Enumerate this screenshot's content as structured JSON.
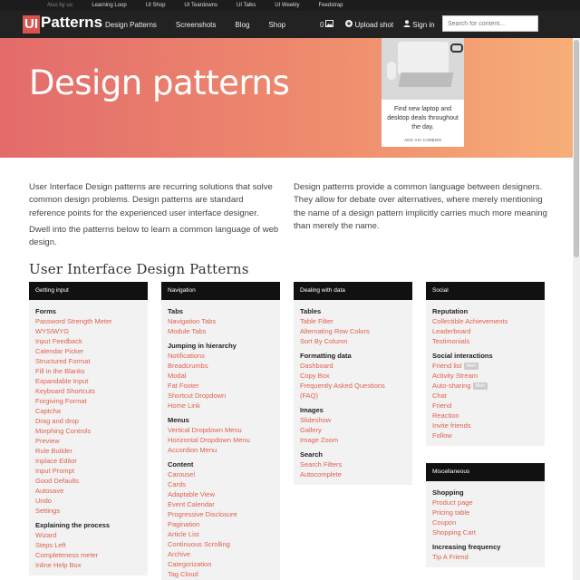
{
  "topbar": {
    "also_label": "Also by us:",
    "links": [
      "Learning Loop",
      "UI Shop",
      "UI Teardowns",
      "UI Talks",
      "UI Weekly",
      "Feedstrap"
    ]
  },
  "nav": {
    "logo_ui": "UI",
    "logo_text": "Patterns",
    "items": [
      "Design Patterns",
      "Screenshots",
      "Blog",
      "Shop"
    ],
    "count": "0",
    "upload": "Upload shot",
    "signin": "Sign in",
    "search_placeholder": "Search for content..."
  },
  "hero": {
    "title": "Design patterns",
    "ad_text": "Find new laptop and desktop deals throughout the day.",
    "ad_via": "ADS VIA CARBON"
  },
  "intro": {
    "left_p1": "User Interface Design patterns are recurring solutions that solve common design problems. Design patterns are standard reference points for the experienced user interface designer.",
    "left_p2": "Dwell into the patterns below to learn a common language of web design.",
    "right_p1": "Design patterns provide a common language between designers. They allow for debate over alternatives, where merely mentioning the name of a design pattern implicitly carries much more meaning than merely the name."
  },
  "section_title": "User Interface Design Patterns",
  "columns": [
    {
      "title": "Getting input",
      "groups": [
        {
          "name": "Forms",
          "links": [
            "Password Strength Meter",
            "WYSIWYG",
            "Input Feedback",
            "Calendar Picker",
            "Structured Format",
            "Fill in the Blanks",
            "Expandable Input",
            "Keyboard Shortcuts",
            "Forgiving Format",
            "Captcha",
            "Drag and drop",
            "Morphing Controls",
            "Preview",
            "Rule Builder",
            "Inplace Editor",
            "Input Prompt",
            "Good Defaults",
            "Autosave",
            "Undo",
            "Settings"
          ]
        },
        {
          "name": "Explaining the process",
          "links": [
            "Wizard",
            "Steps Left",
            "Completeness meter",
            "Inline Help Box"
          ]
        }
      ]
    },
    {
      "title": "Navigation",
      "groups": [
        {
          "name": "Tabs",
          "links": [
            "Navigation Tabs",
            "Module Tabs"
          ]
        },
        {
          "name": "Jumping in hierarchy",
          "links": [
            "Notifications",
            "Breadcrumbs",
            "Modal",
            "Fat Footer",
            "Shortcut Dropdown",
            "Home Link"
          ]
        },
        {
          "name": "Menus",
          "links": [
            "Vertical Dropdown Menu",
            "Horizontal Dropdown Menu",
            "Accordion Menu"
          ]
        },
        {
          "name": "Content",
          "links": [
            "Carousel",
            "Cards",
            "Adaptable View",
            "Event Calendar",
            "Progressive Disclosure",
            "Pagination",
            "Article List",
            "Continuous Scrolling",
            "Archive",
            "Categorization",
            "Tag Cloud"
          ]
        }
      ]
    },
    {
      "title": "Dealing with data",
      "groups": [
        {
          "name": "Tables",
          "links": [
            "Table Filter",
            "Alternating Row Colors",
            "Sort By Column"
          ]
        },
        {
          "name": "Formatting data",
          "links": [
            "Dashboard",
            "Copy Box",
            "Frequently Asked Questions",
            "(FAQ)"
          ]
        },
        {
          "name": "Images",
          "links": [
            "Slideshow",
            "Gallery",
            "Image Zoom"
          ]
        },
        {
          "name": "Search",
          "links": [
            "Search Filters",
            "Autocomplete"
          ]
        }
      ]
    },
    {
      "title": "Social",
      "groups": [
        {
          "name": "Reputation",
          "links": [
            "Collectible Achievements",
            "Leaderboard",
            "Testimonials"
          ]
        },
        {
          "name": "Social interactions",
          "links": [
            "Friend list",
            "Activity Stream",
            "Auto-sharing",
            "Chat",
            "Friend",
            "Reaction",
            "Invite friends",
            "Follow"
          ]
        }
      ],
      "badges": {
        "Friend list": "Meh",
        "Auto-sharing": "Meh"
      }
    },
    {
      "title": "Miscellaneous",
      "groups": [
        {
          "name": "Shopping",
          "links": [
            "Product page",
            "Pricing table",
            "Coupon",
            "Shopping Cart"
          ]
        },
        {
          "name": "Increasing frequency",
          "links": [
            "Tip A Friend"
          ]
        }
      ]
    }
  ],
  "colors": {
    "accent": "#e0604f",
    "navbar": "#222222",
    "hero_start": "#e36b6b",
    "hero_end": "#f7ae78"
  }
}
